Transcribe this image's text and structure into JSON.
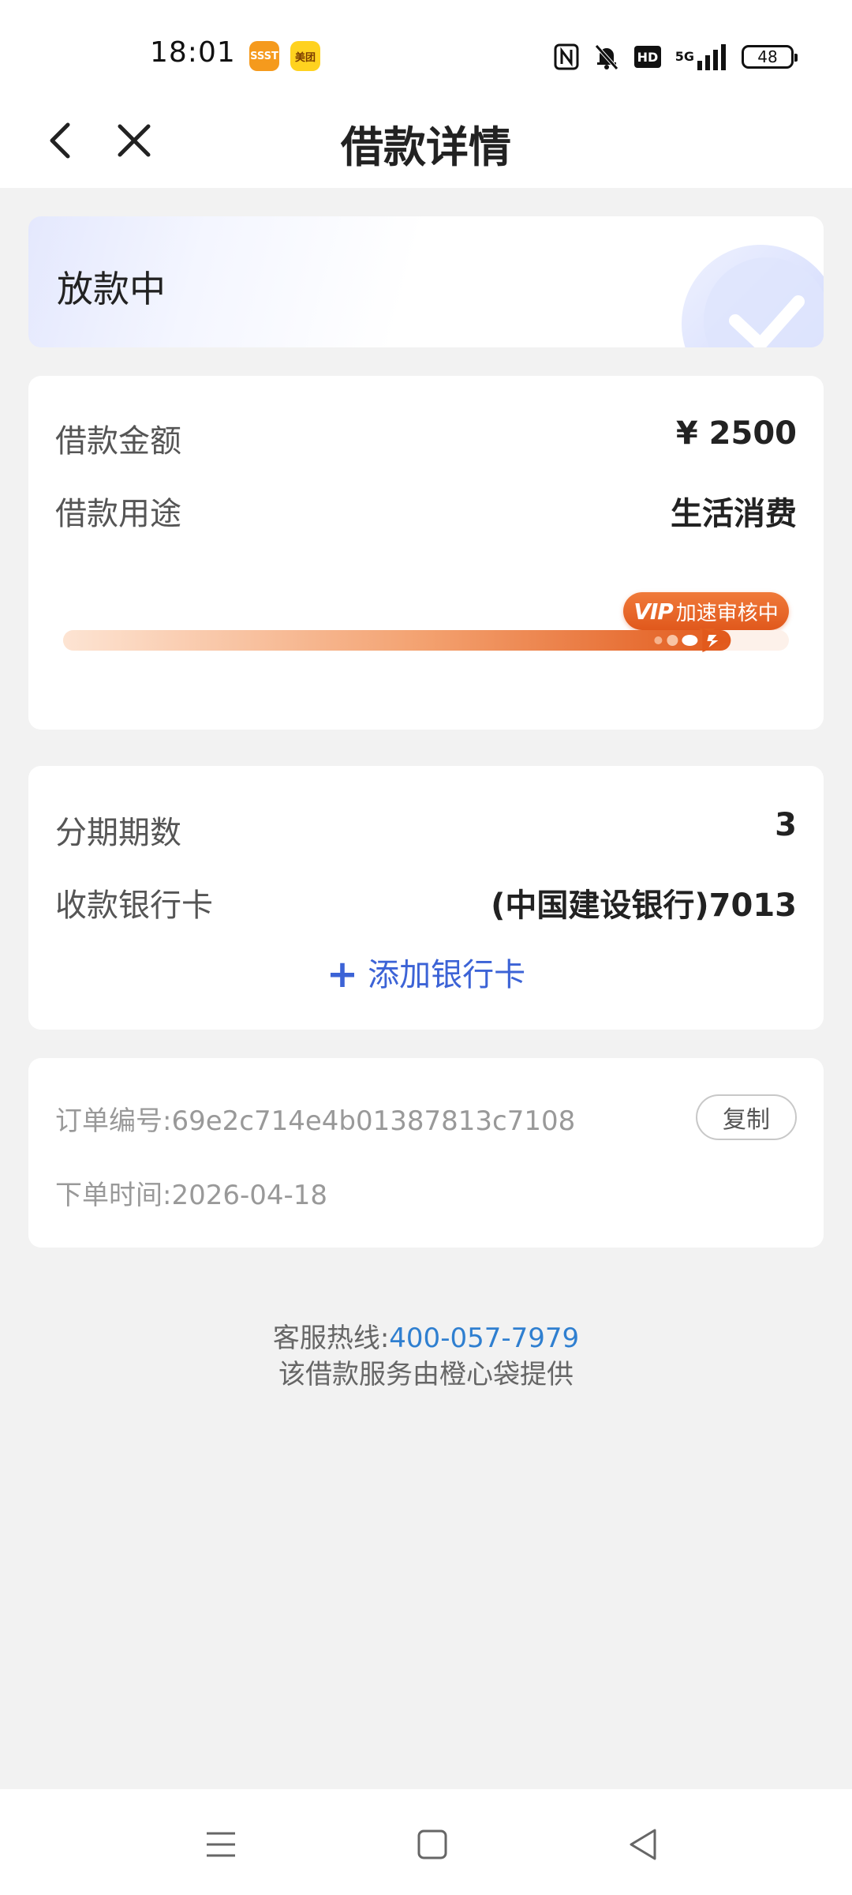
{
  "status_bar": {
    "time": "18:01",
    "app_badges": [
      "SSST",
      "美团"
    ],
    "network": "5G",
    "battery": "48"
  },
  "nav": {
    "title": "借款详情"
  },
  "loan_status": {
    "text": "放款中"
  },
  "loan_info": {
    "amount_label": "借款金额",
    "amount_value": "¥ 2500",
    "purpose_label": "借款用途",
    "purpose_value": "生活消费",
    "progress_tag_vip": "VIP",
    "progress_tag_text": "加速审核中",
    "progress_fraction": 0.92
  },
  "repayment": {
    "installment_label": "分期期数",
    "installment_value": "3",
    "bank_label": "收款银行卡",
    "bank_value": "(中国建设银行)7013",
    "add_card_label": "添加银行卡"
  },
  "order": {
    "number_label": "订单编号:",
    "number_value": "69e2c714e4b01387813c7108",
    "copy_label": "复制",
    "time_label": "下单时间:",
    "time_value": "2026-04-18"
  },
  "footer": {
    "hotline_label": "客服热线:",
    "hotline_number": "400-057-7979",
    "provider_text": "该借款服务由橙心袋提供"
  },
  "icons": {
    "back": "chevron-left-icon",
    "close": "close-icon",
    "status_emblem": "check-circle-icon",
    "sys_menu": "menu-icon",
    "sys_home": "square-home-icon",
    "sys_back": "triangle-back-icon"
  },
  "colors": {
    "accent_orange": "#e8621f",
    "link_blue": "#3c63d6",
    "hotline_blue": "#2f7fd0",
    "page_bg": "#f2f2f2"
  }
}
